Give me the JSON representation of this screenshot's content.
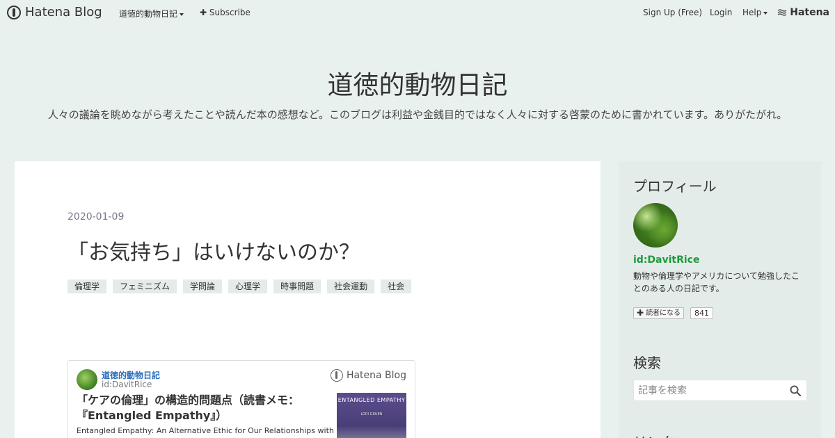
{
  "topbar": {
    "logo_text": "Hatena Blog",
    "blog_menu_label": "道徳的動物日記",
    "subscribe_label": "Subscribe",
    "signup_label": "Sign Up (Free)",
    "login_label": "Login",
    "help_label": "Help",
    "brand_label": "Hatena"
  },
  "header": {
    "title": "道徳的動物日記",
    "description": "人々の議論を眺めながら考えたことや読んだ本の感想など。このブログは利益や金銭目的ではなく人々に対する啓蒙のために書かれています。ありがたがれ。"
  },
  "entry": {
    "date": "2020-01-09",
    "title": "「お気持ち」はいけないのか？",
    "tags": [
      "倫理学",
      "フェミニズム",
      "学問論",
      "心理学",
      "時事問題",
      "社会運動",
      "社会"
    ]
  },
  "embed_card": {
    "blog_name": "道徳的動物日記",
    "author_id": "id:DavitRice",
    "service_label": "Hatena Blog",
    "title": "「ケアの倫理」の構造的問題点（読書メモ：『Entangled Empathy』）",
    "summary": "Entangled Empathy: An Alternative Ethic for Our Relationships with",
    "thumbnail_title": "ENTANGLED EMPATHY",
    "thumbnail_subtitle": "LORI GRUEN"
  },
  "sidebar": {
    "profile_heading": "プロフィール",
    "profile_id": "id:DavitRice",
    "profile_description": "動物や倫理学やアメリカについて勉強したことのある人の日記です。",
    "subscribe_button": "読者になる",
    "subscriber_count": "841",
    "search_heading": "検索",
    "search_placeholder": "記事を検索",
    "link_heading": "リンク"
  },
  "colors": {
    "page_background": "#e9f1ee",
    "sidebar_background": "#e4ece9",
    "profile_id_color": "#1e9a3c",
    "card_link_color": "#2a6ebb"
  }
}
